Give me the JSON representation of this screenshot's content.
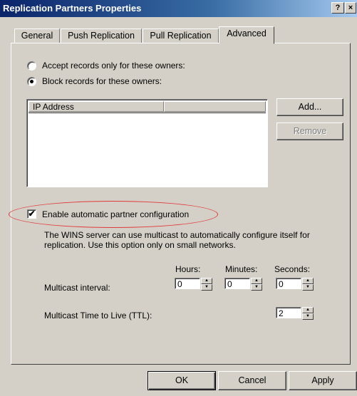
{
  "window": {
    "title": "Replication Partners Properties",
    "help": "?",
    "close": "×"
  },
  "tabs": [
    {
      "label": "General"
    },
    {
      "label": "Push Replication"
    },
    {
      "label": "Pull Replication"
    },
    {
      "label": "Advanced"
    }
  ],
  "owners": {
    "accept_label": "Accept records only for these owners:",
    "block_label": "Block records for these owners:",
    "list_header": "IP Address",
    "add_button": "Add...",
    "remove_button": "Remove"
  },
  "auto_config": {
    "checkbox_label": "Enable automatic partner configuration",
    "checked": true,
    "description": "The WINS server can use multicast to automatically configure itself for replication. Use this option only on small networks."
  },
  "multicast": {
    "hours_label": "Hours:",
    "minutes_label": "Minutes:",
    "seconds_label": "Seconds:",
    "interval_label": "Multicast interval:",
    "hours_value": "0",
    "minutes_value": "0",
    "seconds_value": "0",
    "ttl_label": "Multicast Time to Live (TTL):",
    "ttl_value": "2"
  },
  "footer": {
    "ok": "OK",
    "cancel": "Cancel",
    "apply": "Apply"
  }
}
